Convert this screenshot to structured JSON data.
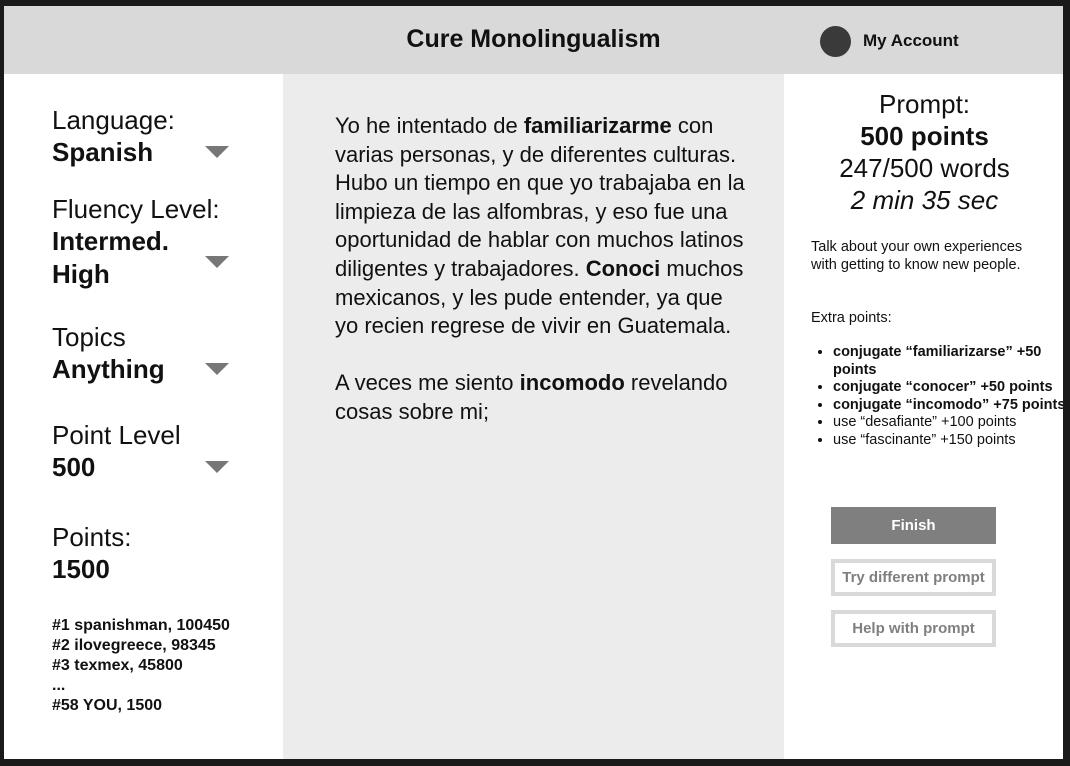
{
  "header": {
    "title": "Cure Monolingualism",
    "account_label": "My Account"
  },
  "sidebar": {
    "language": {
      "label": "Language:",
      "value": "Spanish"
    },
    "fluency": {
      "label": "Fluency Level:",
      "value_line1": "Intermed.",
      "value_line2": "High"
    },
    "topics": {
      "label": "Topics",
      "value": "Anything"
    },
    "point_level": {
      "label": "Point Level",
      "value": "500"
    },
    "points": {
      "label": "Points:",
      "value": "1500"
    },
    "leaderboard": [
      "#1 spanishman, 100450",
      "#2 ilovegreece, 98345",
      "#3 texmex, 45800",
      "...",
      "#58 YOU, 1500"
    ]
  },
  "essay": {
    "p1_a": "Yo he intentado de ",
    "p1_b": "familiarizarme",
    "p1_c": " con varias personas, y de diferentes culturas. Hubo un tiempo en que yo trabajaba en la limpieza de las alfombras, y eso fue una oportunidad de hablar con muchos latinos diligentes y trabajadores. ",
    "p1_d": "Conoci",
    "p1_e": " muchos mexicanos, y les pude entender, ya que yo recien regrese de vivir en Guatemala.",
    "p2_a": "A veces me siento ",
    "p2_b": "incomodo",
    "p2_c": " revelando cosas sobre mi;"
  },
  "prompt": {
    "title": "Prompt:",
    "points": "500 points",
    "word_count": "247/500 words",
    "timer": "2 min 35 sec",
    "text": "Talk about your own experiences with getting to know new people.",
    "extra_title": "Extra points:",
    "extras_bold": [
      "conjugate “familiarizarse” +50 points",
      "conjugate “conocer” +50 points",
      "conjugate “incomodo” +75 points"
    ],
    "extras": [
      "use “desafiante” +100 points",
      "use “fascinante” +150 points"
    ]
  },
  "buttons": {
    "finish": "Finish",
    "try_different": "Try different prompt",
    "help": "Help with prompt"
  },
  "colors": {
    "header_bg": "#d9d9d9",
    "center_bg": "#ececec",
    "finish_bg": "#7f7f7f",
    "caret": "#777777"
  },
  "icons": [
    "avatar-icon",
    "chevron-down-icon"
  ]
}
